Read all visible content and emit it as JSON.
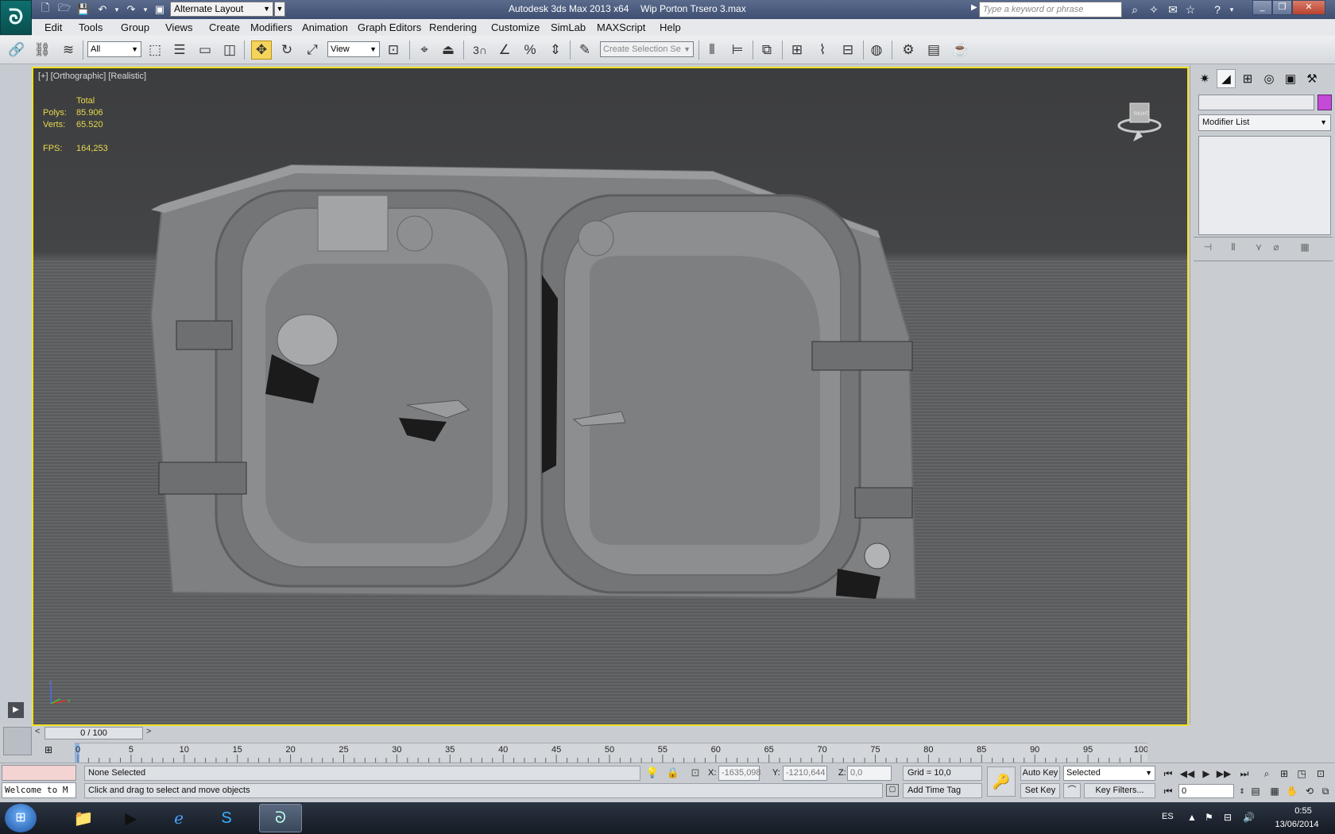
{
  "titlebar": {
    "workspace": "Alternate Layout",
    "app_title": "Autodesk 3ds Max  2013 x64",
    "file_title": "Wip Porton Trsero 3.max",
    "search_placeholder": "Type a keyword or phrase"
  },
  "menu": [
    "Edit",
    "Tools",
    "Group",
    "Views",
    "Create",
    "Modifiers",
    "Animation",
    "Graph Editors",
    "Rendering",
    "Customize",
    "SimLab",
    "MAXScript",
    "Help"
  ],
  "toolbar": {
    "selection_filter": "All",
    "ref_coord": "View",
    "named_selection_placeholder": "Create Selection Se",
    "snap_number": "3"
  },
  "viewport": {
    "label": "[+] [Orthographic] [Realistic]",
    "stats_header": "Total",
    "polys_label": "Polys:",
    "polys_value": "85.906",
    "verts_label": "Verts:",
    "verts_value": "65.520",
    "fps_label": "FPS:",
    "fps_value": "164,253",
    "viewcube_label": "RIGHT",
    "axis_x": "x",
    "axis_z": "z"
  },
  "command_panel": {
    "modifier_list": "Modifier List",
    "object_color": "#c44ad8"
  },
  "timeline": {
    "slider_text": "0 / 100",
    "ticks": [
      "0",
      "5",
      "10",
      "15",
      "20",
      "25",
      "30",
      "35",
      "40",
      "45",
      "50",
      "55",
      "60",
      "65",
      "70",
      "75",
      "80",
      "85",
      "90",
      "95",
      "100"
    ]
  },
  "statusbar": {
    "listener_text": "Welcome to M",
    "selection_status": "None Selected",
    "prompt": "Click and drag to select and move objects",
    "x_label": "X:",
    "x_value": "-1635,098",
    "y_label": "Y:",
    "y_value": "-1210,644",
    "z_label": "Z:",
    "z_value": "0,0",
    "grid": "Grid = 10,0",
    "add_time_tag": "Add Time Tag",
    "auto_key": "Auto Key",
    "set_key": "Set Key",
    "key_mode": "Selected",
    "key_filters": "Key Filters...",
    "frame_value": "0"
  },
  "taskbar": {
    "language": "ES",
    "time": "0:55",
    "date": "13/06/2014"
  },
  "colors": {
    "viewport_border": "#f0e022",
    "stat_text": "#e8d84a",
    "active_tool": "#f5d45a"
  }
}
